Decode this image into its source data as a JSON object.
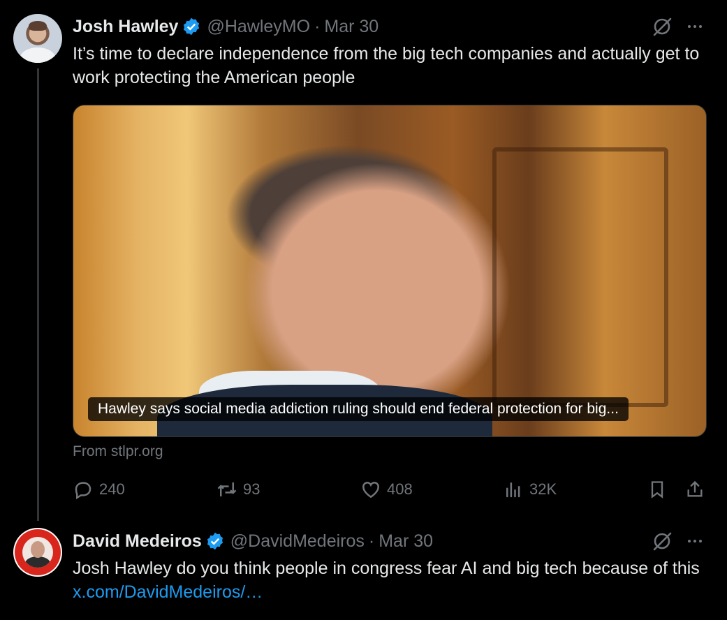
{
  "tweets": [
    {
      "author": {
        "name": "Josh Hawley",
        "handle": "@HawleyMO",
        "separator": "·",
        "date": "Mar 30",
        "verified": true
      },
      "text": "It’s time to declare independence from the big tech companies and actually get to work protecting the American people",
      "card": {
        "caption": "Hawley says social media addiction ruling should end federal protection for big...",
        "source": "From stlpr.org"
      },
      "actions": {
        "replies": "240",
        "reposts": "93",
        "likes": "408",
        "views": "32K"
      }
    },
    {
      "author": {
        "name": "David Medeiros",
        "handle": "@DavidMedeiros",
        "separator": "·",
        "date": "Mar 30",
        "verified": true
      },
      "text_prefix": "Josh Hawley do you think people in congress fear AI and big tech because of this ",
      "link": "x.com/DavidMedeiros/…"
    }
  ],
  "colors": {
    "background": "#000000",
    "text": "#e7e9ea",
    "secondary": "#71767b",
    "link": "#1d9bf0",
    "verified": "#1d9bf0"
  },
  "icons": [
    "grok-icon",
    "more-icon",
    "reply-icon",
    "repost-icon",
    "like-icon",
    "views-icon",
    "bookmark-icon",
    "share-icon",
    "verified-badge-icon"
  ]
}
